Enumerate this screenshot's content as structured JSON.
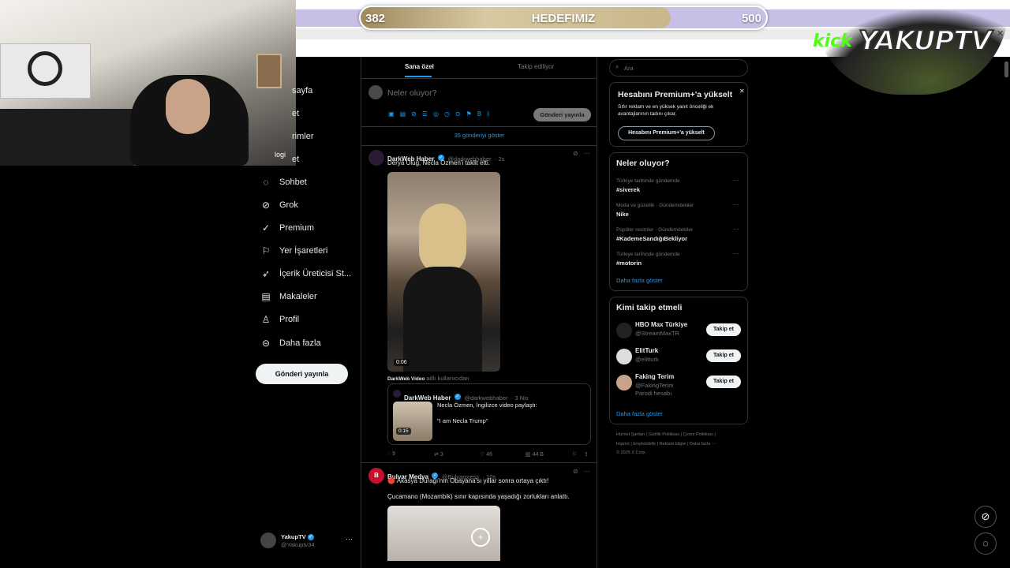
{
  "goal": {
    "current": "382",
    "title": "HEDEFIMIZ",
    "target": "500",
    "progress_fraction": 0.764
  },
  "logo": {
    "kick": "kick",
    "brand": "YAKUPTV"
  },
  "nav": {
    "items": [
      {
        "label": "sayfa",
        "icon": "home-icon"
      },
      {
        "label": "et",
        "icon": "search-icon"
      },
      {
        "label": "rimler",
        "icon": "bell-icon"
      },
      {
        "label": "et",
        "icon": "mail-icon"
      },
      {
        "label": "Sohbet",
        "icon": "chat-icon"
      },
      {
        "label": "Grok",
        "icon": "grok-icon"
      },
      {
        "label": "Premium",
        "icon": "premium-icon"
      },
      {
        "label": "Yer İşaretleri",
        "icon": "bookmark-icon"
      },
      {
        "label": "İçerik Üreticisi St...",
        "icon": "rocket-icon"
      },
      {
        "label": "Makaleler",
        "icon": "article-icon"
      },
      {
        "label": "Profil",
        "icon": "person-icon"
      },
      {
        "label": "Daha fazla",
        "icon": "more-circle-icon"
      }
    ],
    "cam_overlay": "logi",
    "post_button": "Gönderi yayınla",
    "user": {
      "name": "YakupTV",
      "handle": "@Yakuptv34",
      "more": "···"
    }
  },
  "feed": {
    "tabs": [
      "Sana özel",
      "Takip ediliyor"
    ],
    "compose_placeholder": "Neler oluyor?",
    "compose_button": "Gönderi yayınla",
    "show_more": "35 gönderiyi göster",
    "tweets": [
      {
        "name": "DarkWeb Haber",
        "handle": "@darkwebhaber",
        "time": "· 2s",
        "text": "Derya Uluğ, Necla Özmen'i taklit etti.",
        "video_time": "0:06",
        "via": "DarkWeb Video",
        "via_suffix": "adlı kullanıcıdan",
        "quote": {
          "name": "DarkWeb Haber",
          "handle": "@darkwebhaber",
          "time": "· 3 Nis",
          "text1": "Necla Özmen, İngilizce video paylaştı:",
          "text2": "\"I am Necla Trump\"",
          "video_time": "0:15"
        },
        "stats": {
          "replies": "9",
          "retweets": "3",
          "likes": "46",
          "views": "44 B"
        }
      },
      {
        "name": "Bulvar Medya",
        "handle": "@Bulvarpress",
        "time": "· 10s",
        "text": "🔴 Akasya Durağı'nın Obayana'sı yıllar sonra ortaya çıktı!",
        "text2": "Çucamano (Mozambik) sınır kapısında yaşadığı zorlukları anlattı."
      }
    ]
  },
  "right": {
    "search_placeholder": "Ara",
    "premium": {
      "title": "Hesabını Premium+'a yükselt",
      "body": "Sıfır reklam ve en yüksek yanıt önceliği ek avantajlarının tadını çıkar.",
      "button": "Hesabını Premium+'a yükselt"
    },
    "trends": {
      "title": "Neler oluyor?",
      "items": [
        {
          "meta": "Türkiye tarihinde gündemde",
          "name": "#siverek"
        },
        {
          "meta": "Moda ve güzellik · Gündemdekiler",
          "name": "Nike"
        },
        {
          "meta": "Popüler resimler · Gündemdekiler",
          "name": "#KademeSandığıBekliyor"
        },
        {
          "meta": "Türkiye tarihinde gündemde",
          "name": "#motorin"
        }
      ],
      "more": "Daha fazla göster"
    },
    "who": {
      "title": "Kimi takip etmeli",
      "items": [
        {
          "name": "HBO Max Türkiye",
          "handle": "@StreamMaxTR",
          "button": "Takip et",
          "extra": ""
        },
        {
          "name": "ElitTurk",
          "handle": "@elitturk",
          "button": "Takip et",
          "extra": ""
        },
        {
          "name": "Faking Terim",
          "handle": "@FakingTerim",
          "button": "Takip et",
          "extra": "Parodi hesabı"
        }
      ],
      "more": "Daha fazla göster"
    },
    "footer": {
      "line1": "Hizmet Şartları | Gizlilik Politikası | Çerez Politikası |",
      "line2": "Imprint | Erişilebilirlik | Reklam bilgisi | Daha fazla ···",
      "line3": "© 2025 X Corp."
    }
  },
  "colors": {
    "accent": "#1d9bf0",
    "goal_bar": "#c8bfe6",
    "goal_fill": "#c9b68a",
    "kick": "#53fc18"
  }
}
